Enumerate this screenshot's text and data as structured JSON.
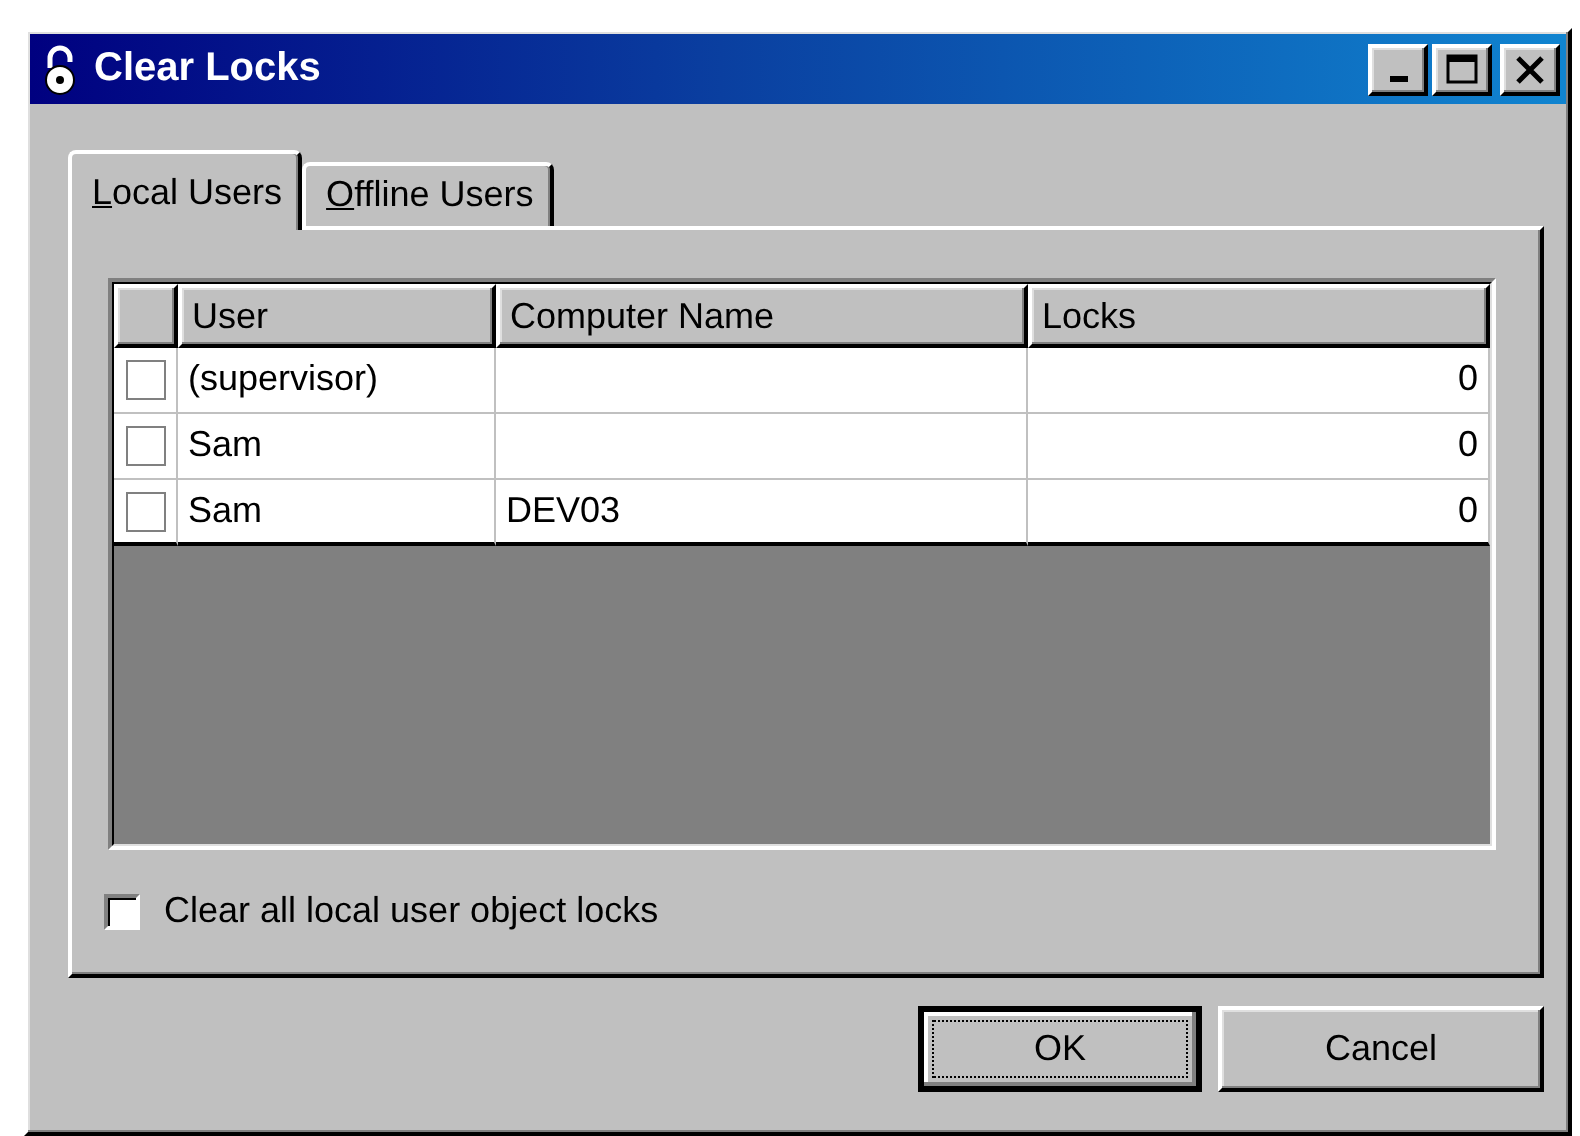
{
  "window": {
    "title": "Clear Locks"
  },
  "tabs": [
    {
      "label": "Local Users",
      "selected": true
    },
    {
      "label": "Offline Users",
      "selected": false
    }
  ],
  "table": {
    "columns": [
      "User",
      "Computer Name",
      "Locks"
    ],
    "rows": [
      {
        "checked": false,
        "user": "(supervisor)",
        "locks": "0"
      },
      {
        "checked": false,
        "user": "Sam",
        "locks": "0"
      },
      {
        "checked": false,
        "user": "Sam",
        "computer_name": "DEV03",
        "locks": "0"
      }
    ]
  },
  "clear_all": {
    "label": "Clear all local user object locks",
    "checked": false
  },
  "buttons": [
    {
      "label": "OK",
      "default": true
    },
    {
      "label": "Cancel",
      "default": false
    }
  ]
}
